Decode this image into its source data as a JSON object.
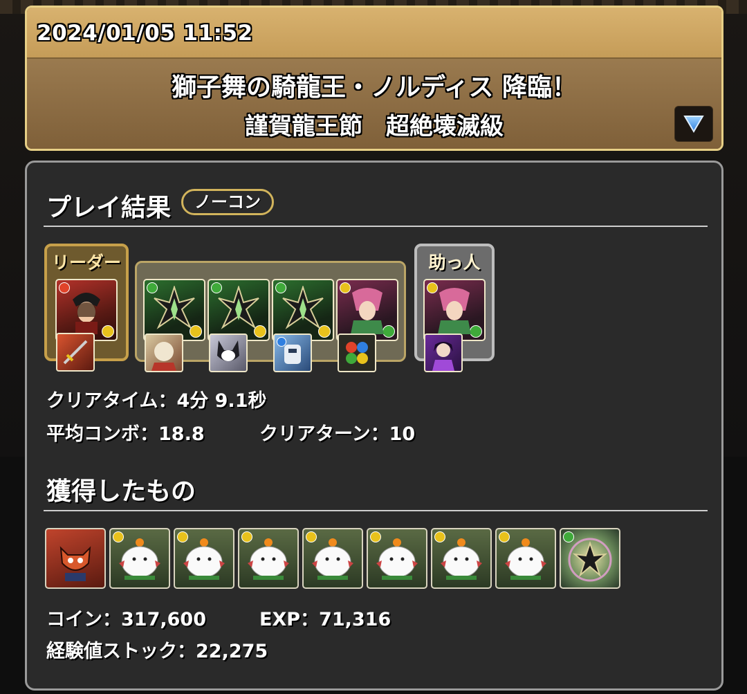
{
  "header": {
    "datetime": "2024/01/05 11:52",
    "title_line1": "獅子舞の騎龍王・ノルディス 降臨！",
    "title_line2": "謹賀龍王節　超絶壊滅級"
  },
  "results": {
    "section_title": "プレイ結果",
    "badge": "ノーコン",
    "leader_label": "リーダー",
    "helper_label": "助っ人",
    "stats": {
      "clear_time": "クリアタイム：4分 9.1秒",
      "avg_combo": "平均コンボ：18.8",
      "clear_turn": "クリアターン：10"
    }
  },
  "rewards": {
    "section_title": "獲得したもの",
    "coin": "コイン：317,600",
    "exp": "EXP：71,316",
    "exp_stock": "経験値ストック：22,275"
  },
  "colors": {
    "fire": "#e0432a",
    "wood": "#3faa3a",
    "light": "#e8c21c",
    "water": "#2f7fe0",
    "dark": "#8a3fc8",
    "frame_gold": "#c7a04a"
  }
}
